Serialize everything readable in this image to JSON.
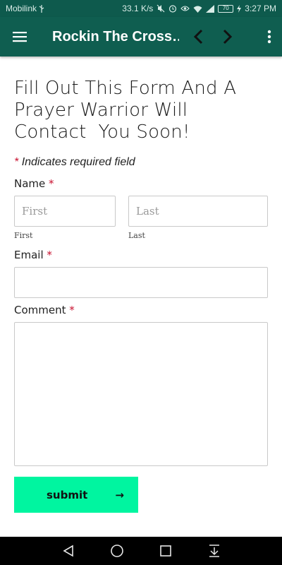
{
  "status_bar": {
    "carrier": "Mobilink",
    "speed": "33.1 K/s",
    "battery": "70",
    "time": "3:27 PM"
  },
  "app_bar": {
    "title": "Rockin The Cross…"
  },
  "form": {
    "heading": "Fill Out This Form And A\nPrayer Warrior Will\nContact  You Soon!",
    "required_star": "*",
    "required_note": "Indicates required field",
    "name_label": "Name",
    "first_placeholder": "First",
    "first_sublabel": "First",
    "last_placeholder": "Last",
    "last_sublabel": "Last",
    "email_label": "Email",
    "email_value": "",
    "comment_label": "Comment",
    "comment_value": "",
    "submit_label": "submit",
    "submit_arrow": "→"
  },
  "colors": {
    "app_bar": "#0f5e50",
    "submit": "#00f5a0",
    "required": "#c8102e"
  }
}
